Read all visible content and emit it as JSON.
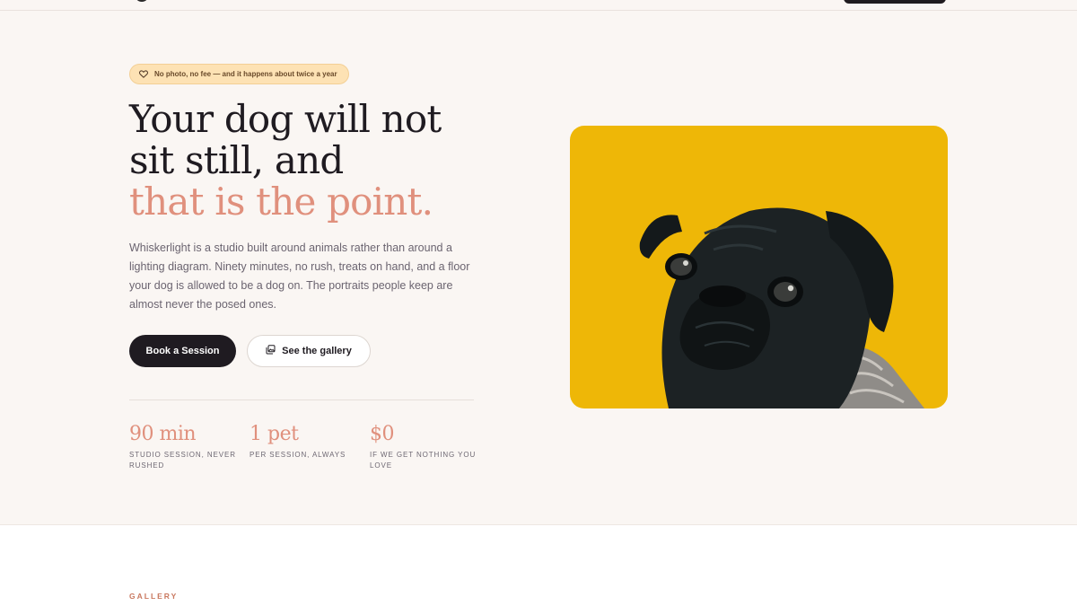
{
  "hero": {
    "badge": "No photo, no fee — and it happens about twice a year",
    "headline_line1": "Your dog will not",
    "headline_line2": "sit still, and",
    "headline_accent": "that is the point.",
    "lead": "Whiskerlight is a studio built around animals rather than around a lighting diagram. Ninety minutes, no rush, treats on hand, and a floor your dog is allowed to be a dog on. The portraits people keep are almost never the posed ones.",
    "primary_button": "Book a Session",
    "secondary_button": "See the gallery",
    "stats": [
      {
        "value": "90 min",
        "label": "Studio session, never rushed"
      },
      {
        "value": "1 pet",
        "label": "Per session, always"
      },
      {
        "value": "$0",
        "label": "If we get nothing you love"
      }
    ],
    "photo_subject": "black pug on yellow background"
  },
  "gallery": {
    "eyebrow": "GALLERY"
  },
  "colors": {
    "accent": "#e0907d",
    "dark": "#1f1b21",
    "photo_bg": "#eeb707",
    "badge_bg": "#fde2b4",
    "hero_bg": "#faf6f3"
  },
  "icons": {
    "badge": "heart-icon",
    "gallery_button": "gallery-icon"
  }
}
